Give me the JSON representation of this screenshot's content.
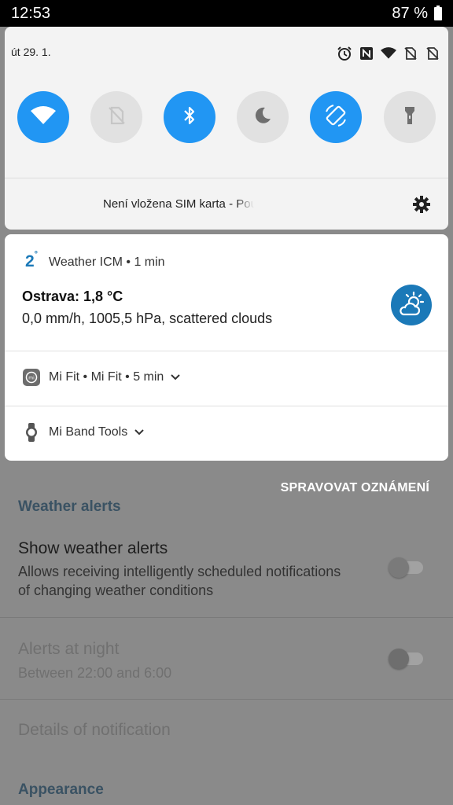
{
  "status_bar": {
    "time": "12:53",
    "battery_text": "87 %"
  },
  "quick_settings": {
    "date": "út 29. 1.",
    "system_icons": [
      "alarm-icon",
      "nfc-icon",
      "wifi-signal-icon",
      "sim-off-icon",
      "sim-off-icon"
    ],
    "tiles": [
      {
        "name": "wifi",
        "icon": "wifi-icon",
        "state": "on"
      },
      {
        "name": "mobile-data",
        "icon": "sim-off-icon",
        "state": "disabled"
      },
      {
        "name": "bluetooth",
        "icon": "bluetooth-icon",
        "state": "on"
      },
      {
        "name": "do-not-disturb",
        "icon": "moon-icon",
        "state": "off"
      },
      {
        "name": "auto-rotate",
        "icon": "rotate-icon",
        "state": "on"
      },
      {
        "name": "flashlight",
        "icon": "flashlight-icon",
        "state": "off"
      }
    ],
    "sim_status": "Není vložena SIM karta - Pouze tísňová volání",
    "accent_color": "#2196f3"
  },
  "notifications": [
    {
      "app": "Weather ICM • 1 min",
      "small_icon_text": "2",
      "small_icon_sup": "°",
      "title": "Ostrava: 1,8 °C",
      "text": "0,0 mm/h, 1005,5 hPa, scattered clouds",
      "large_icon": "partly-cloudy-icon"
    },
    {
      "app": "Mi Fit • Mi Fit • 5 min",
      "icon": "mi-fit-icon"
    },
    {
      "app": "Mi Band Tools",
      "icon": "watch-icon"
    }
  ],
  "manage_notifications": "SPRAVOVAT OZNÁMENÍ",
  "background_app": {
    "section_weather_alerts": "Weather alerts",
    "show_alerts_title": "Show weather alerts",
    "show_alerts_desc": "Allows receiving intelligently scheduled notifications of changing weather conditions",
    "alerts_night_title": "Alerts at night",
    "alerts_night_desc": "Between 22:00 and 6:00",
    "details_title": "Details of notification",
    "section_appearance": "Appearance"
  }
}
